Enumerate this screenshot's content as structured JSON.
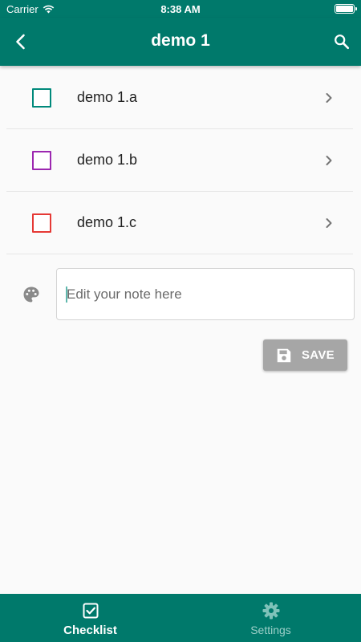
{
  "status_bar": {
    "carrier": "Carrier",
    "time": "8:38 AM"
  },
  "app_bar": {
    "title": "demo 1",
    "back_icon": "arrow-back-icon",
    "search_icon": "search-icon"
  },
  "colors": {
    "primary": "#00796b",
    "save_disabled": "#a6a6a6"
  },
  "checklist": {
    "items": [
      {
        "label": "demo 1.a",
        "checked": false,
        "color": "#00897b"
      },
      {
        "label": "demo 1.b",
        "checked": false,
        "color": "#9c27b0"
      },
      {
        "label": "demo 1.c",
        "checked": false,
        "color": "#e53935"
      }
    ]
  },
  "note": {
    "placeholder": "Edit your note here",
    "value": ""
  },
  "save_button": {
    "label": "SAVE"
  },
  "bottom_nav": {
    "tabs": [
      {
        "label": "Checklist",
        "icon": "checkbox-icon",
        "active": true
      },
      {
        "label": "Settings",
        "icon": "gear-icon",
        "active": false
      }
    ]
  }
}
